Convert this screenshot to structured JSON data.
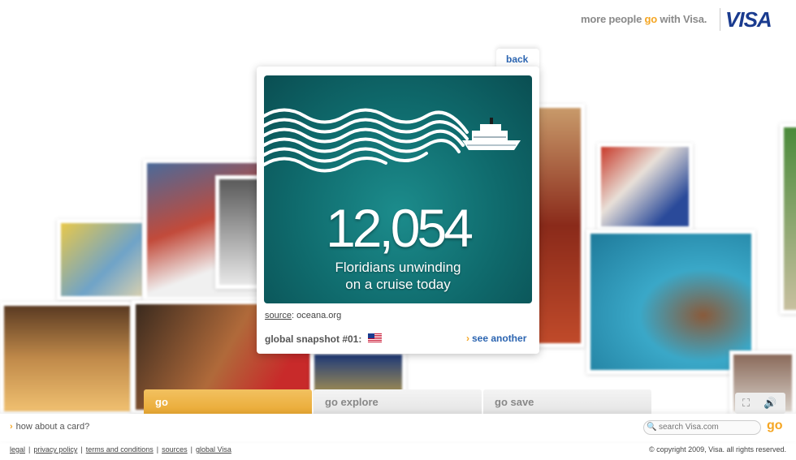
{
  "header": {
    "tagline_pre": "more people ",
    "tagline_go": "go",
    "tagline_post": " with Visa.",
    "logo_text": "VISA"
  },
  "card": {
    "back_label": "back",
    "stat_number": "12,054",
    "stat_caption_line1": "Floridians unwinding",
    "stat_caption_line2": "on a cruise today",
    "source_label": "source",
    "source_value": ": oceana.org",
    "snapshot_label": "global snapshot #01:",
    "see_another_label": "see another"
  },
  "tabs": [
    {
      "label": "go"
    },
    {
      "label": "go explore"
    },
    {
      "label": "go save"
    }
  ],
  "bottom": {
    "how_about": "how about  a card?",
    "search_placeholder": "search Visa.com",
    "search_go": "go"
  },
  "footer": {
    "links": [
      "legal",
      "privacy policy",
      "terms and conditions",
      "sources",
      "global Visa"
    ],
    "copyright": "© copyright 2009, Visa. all rights reserved."
  },
  "colors": {
    "accent": "#f5a623",
    "brand_blue": "#1a3b8f",
    "link_blue": "#2b64b0",
    "panel_teal": "#0f6a6c"
  }
}
